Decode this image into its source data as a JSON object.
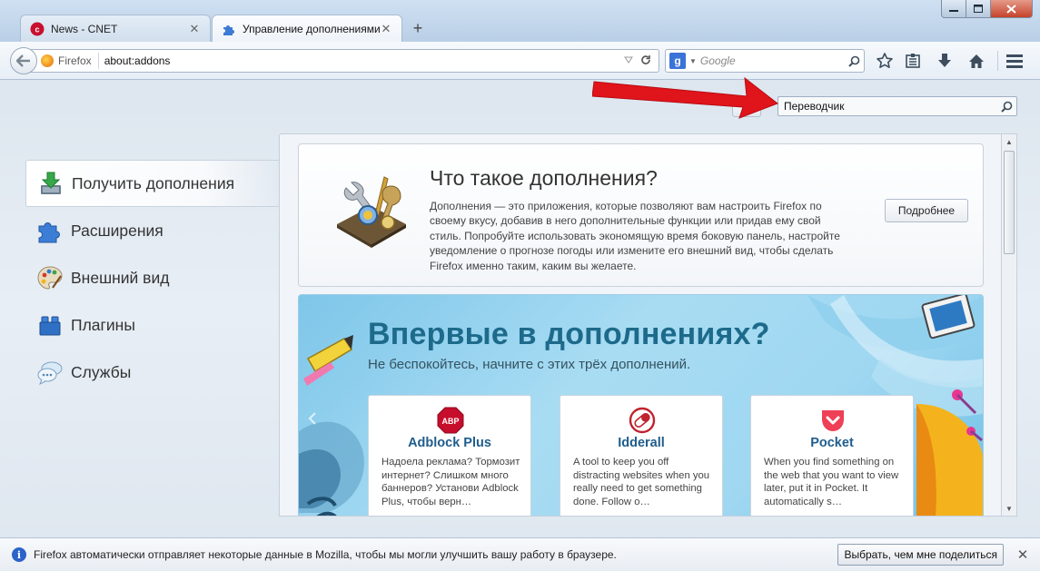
{
  "browser": {
    "tabs": [
      {
        "title": "News - CNET",
        "icon": "cnet-icon",
        "active": false
      },
      {
        "title": "Управление дополнениями",
        "icon": "puzzle-icon",
        "active": true
      }
    ],
    "new_tab": "+",
    "identity_label": "Firefox",
    "url": "about:addons",
    "search_engine": "g",
    "search_placeholder": "Google"
  },
  "addons": {
    "search_value": "Переводчик",
    "categories": [
      {
        "label": "Получить дополнения",
        "icon": "download-icon",
        "selected": true
      },
      {
        "label": "Расширения",
        "icon": "puzzle-icon",
        "selected": false
      },
      {
        "label": "Внешний вид",
        "icon": "palette-icon",
        "selected": false
      },
      {
        "label": "Плагины",
        "icon": "lego-icon",
        "selected": false
      },
      {
        "label": "Службы",
        "icon": "chat-bubbles-icon",
        "selected": false
      }
    ],
    "intro": {
      "title": "Что такое дополнения?",
      "description": "Дополнения — это приложения, которые позволяют вам настроить Firefox по своему вкусу, добавив в него дополнительные функции или придав ему свой стиль. Попробуйте использовать экономящую время боковую панель, настройте уведомление о прогнозе погоды или измените его внешний вид, чтобы сделать Firefox именно таким, каким вы желаете.",
      "more_button": "Подробнее"
    },
    "promo": {
      "title": "Впервые в дополнениях?",
      "subtitle": "Не беспокойтесь, начните с этих трёх дополнений.",
      "cards": [
        {
          "name": "Adblock Plus",
          "logo_text": "ABP",
          "description": "Надоела реклама? Тормозит интернет? Слишком много баннеров? Установи Adblock Plus, чтобы верн…"
        },
        {
          "name": "Idderall",
          "description": "A tool to keep you off distracting websites when you really need to get something done. Follow o…"
        },
        {
          "name": "Pocket",
          "description": "When you find something on the web that you want to view later, put it in Pocket. It automatically s…"
        }
      ]
    }
  },
  "notification": {
    "info_glyph": "i",
    "message": "Firefox автоматически отправляет некоторые данные в Mozilla, чтобы мы могли улучшить вашу работу в браузере.",
    "button": "Выбрать, чем мне поделиться",
    "close": "✕"
  },
  "colors": {
    "accent_arrow": "#e0141b",
    "promo_title": "#1d6a8a",
    "card_title": "#1f5d8c"
  }
}
